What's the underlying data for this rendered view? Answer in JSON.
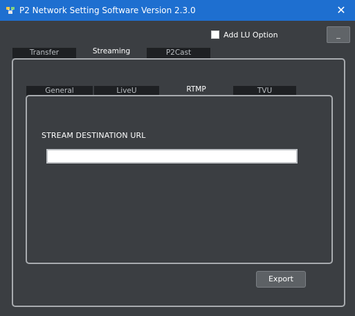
{
  "window": {
    "title": "P2 Network Setting Software  Version 2.3.0",
    "close_glyph": "✕"
  },
  "options": {
    "add_lu_label": "Add LU Option",
    "add_lu_checked": false,
    "minimize_label": "_"
  },
  "main_tabs": [
    {
      "label": "Transfer",
      "active": false
    },
    {
      "label": "Streaming",
      "active": true
    },
    {
      "label": "P2Cast",
      "active": false
    }
  ],
  "sub_tabs": [
    {
      "label": "General",
      "active": false
    },
    {
      "label": "LiveU",
      "active": false
    },
    {
      "label": "RTMP",
      "active": true
    },
    {
      "label": "TVU",
      "active": false
    }
  ],
  "rtmp": {
    "stream_destination_label": "STREAM DESTINATION URL",
    "stream_destination_value": ""
  },
  "footer": {
    "export_label": "Export"
  },
  "colors": {
    "titlebar": "#1e6fd0",
    "window_bg": "#3b3e42",
    "inactive_tab": "#1e2023",
    "panel_border": "#a8abaf"
  },
  "icons": {
    "app": "network-icon",
    "close": "close-icon"
  }
}
